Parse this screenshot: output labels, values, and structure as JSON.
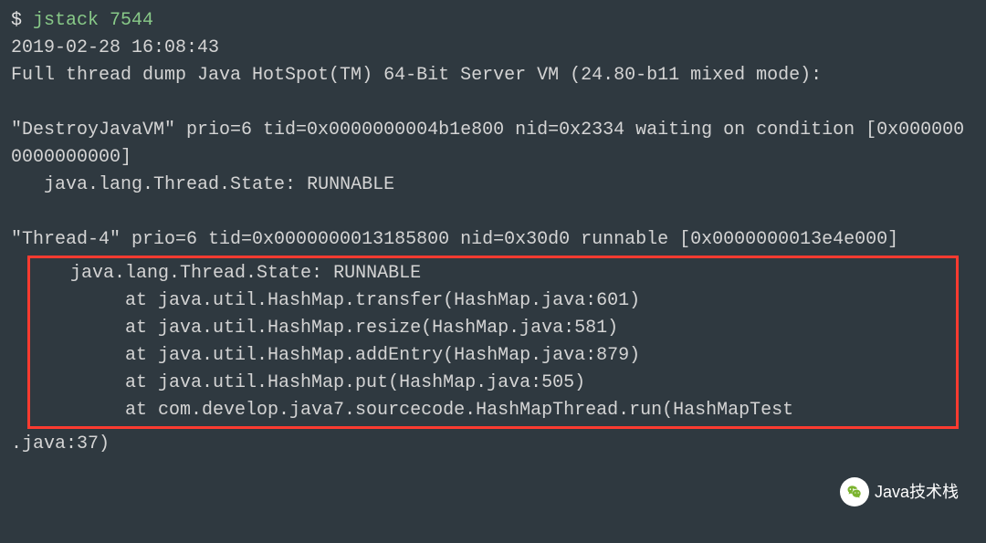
{
  "prompt": "$ ",
  "command": "jstack 7544",
  "timestamp": "2019-02-28 16:08:43",
  "header": "Full thread dump Java HotSpot(TM) 64-Bit Server VM (24.80-b11 mixed mode):",
  "thread1": {
    "line1": "\"DestroyJavaVM\" prio=6 tid=0x0000000004b1e800 nid=0x2334 waiting on condition [0x0000000000000000]",
    "state": "   java.lang.Thread.State: RUNNABLE"
  },
  "thread2": {
    "line1": "\"Thread-4\" prio=6 tid=0x0000000013185800 nid=0x30d0 runnable [0x0000000013e4e000]",
    "state": "   java.lang.Thread.State: RUNNABLE",
    "stack": [
      "        at java.util.HashMap.transfer(HashMap.java:601)",
      "        at java.util.HashMap.resize(HashMap.java:581)",
      "        at java.util.HashMap.addEntry(HashMap.java:879)",
      "        at java.util.HashMap.put(HashMap.java:505)",
      "        at com.develop.java7.sourcecode.HashMapThread.run(HashMapTest"
    ],
    "stackTail": ".java:37)"
  },
  "watermark": "Java技术栈"
}
